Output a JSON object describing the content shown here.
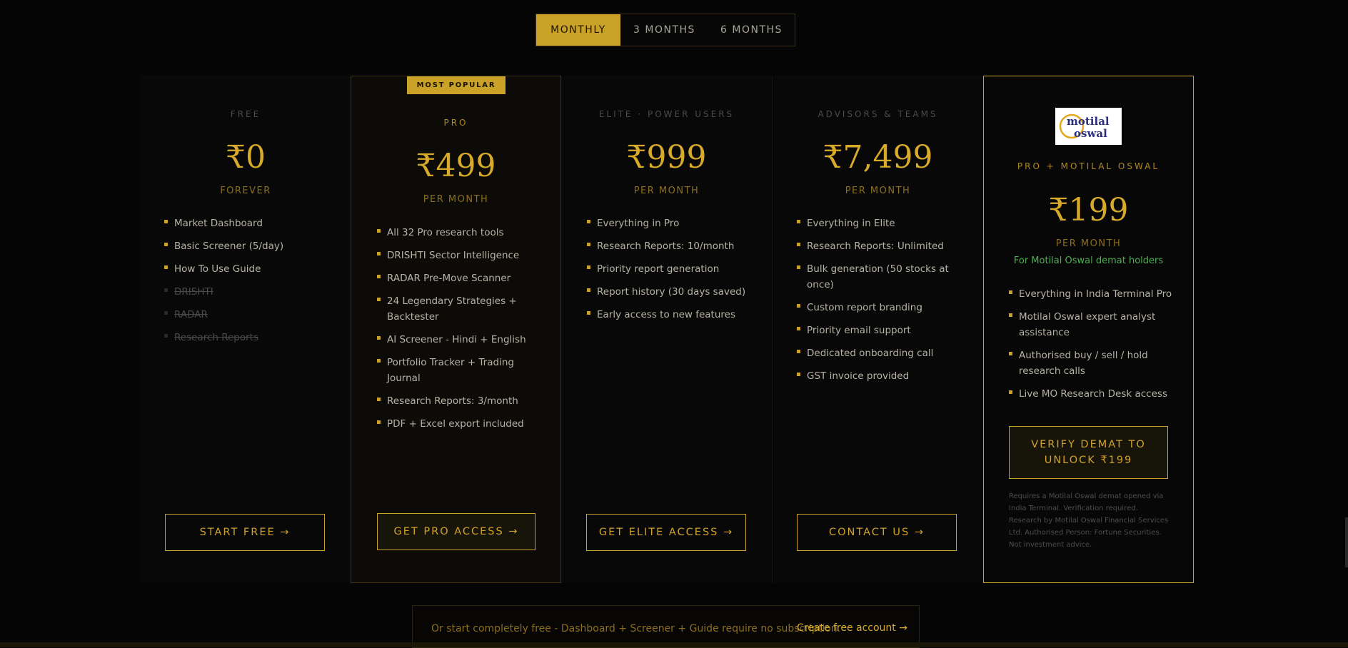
{
  "billing_toggle": {
    "options": [
      {
        "label": "MONTHLY",
        "active": true
      },
      {
        "label": "3 MONTHS",
        "active": false
      },
      {
        "label": "6 MONTHS",
        "active": false
      }
    ]
  },
  "plans": {
    "free": {
      "tier": "FREE",
      "price": "₹0",
      "period": "FOREVER",
      "features": [
        {
          "text": "Market Dashboard",
          "included": true
        },
        {
          "text": "Basic Screener (5/day)",
          "included": true
        },
        {
          "text": "How To Use Guide",
          "included": true
        },
        {
          "text": "DRISHTI",
          "included": false
        },
        {
          "text": "RADAR",
          "included": false
        },
        {
          "text": "Research Reports",
          "included": false
        }
      ],
      "cta": "START FREE →"
    },
    "pro": {
      "badge": "MOST POPULAR",
      "tier": "PRO",
      "price": "₹499",
      "period": "PER MONTH",
      "features": [
        {
          "text": "All 32 Pro research tools"
        },
        {
          "text": "DRISHTI Sector Intelligence"
        },
        {
          "text": "RADAR Pre-Move Scanner"
        },
        {
          "text": "24 Legendary Strategies + Backtester"
        },
        {
          "text": "AI Screener - Hindi + English"
        },
        {
          "text": "Portfolio Tracker + Trading Journal"
        },
        {
          "text": "Research Reports: 3/month"
        },
        {
          "text": "PDF + Excel export included"
        }
      ],
      "cta": "GET PRO ACCESS →"
    },
    "elite": {
      "tier": "ELITE · POWER USERS",
      "price": "₹999",
      "period": "PER MONTH",
      "features": [
        {
          "text": "Everything in Pro"
        },
        {
          "text": "Research Reports: 10/month"
        },
        {
          "text": "Priority report generation"
        },
        {
          "text": "Report history (30 days saved)"
        },
        {
          "text": "Early access to new features"
        }
      ],
      "cta": "GET ELITE ACCESS →"
    },
    "advisors": {
      "tier": "ADVISORS & TEAMS",
      "price": "₹7,499",
      "period": "PER MONTH",
      "features": [
        {
          "text": "Everything in Elite"
        },
        {
          "text": "Research Reports: Unlimited"
        },
        {
          "text": "Bulk generation (50 stocks at once)"
        },
        {
          "text": "Custom report branding"
        },
        {
          "text": "Priority email support"
        },
        {
          "text": "Dedicated onboarding call"
        },
        {
          "text": "GST invoice provided"
        }
      ],
      "cta": "CONTACT US →"
    },
    "partner": {
      "logo_text_line1": "motilal",
      "logo_text_line2": "oswal",
      "tier": "PRO + MOTILAL OSWAL",
      "price": "₹199",
      "period": "PER MONTH",
      "note": "For Motilal Oswal demat holders",
      "features": [
        {
          "text": "Everything in India Terminal Pro"
        },
        {
          "text": "Motilal Oswal expert analyst assistance"
        },
        {
          "text": "Authorised buy / sell / hold research calls"
        },
        {
          "text": "Live MO Research Desk access"
        }
      ],
      "cta_line1": "VERIFY DEMAT TO",
      "cta_line2": "UNLOCK ₹199",
      "fine_print": "Requires a Motilal Oswal demat opened via India Terminal. Verification required. Research by Motilal Oswal Financial Services Ltd. Authorised Person: Fortune Securities. Not investment advice."
    }
  },
  "footer": {
    "text": "Or start completely free - Dashboard + Screener + Guide require no subscription.",
    "link": "Create free account →"
  },
  "colors": {
    "accent": "#c9a227",
    "background": "#050505",
    "note_green": "#4caf50"
  }
}
